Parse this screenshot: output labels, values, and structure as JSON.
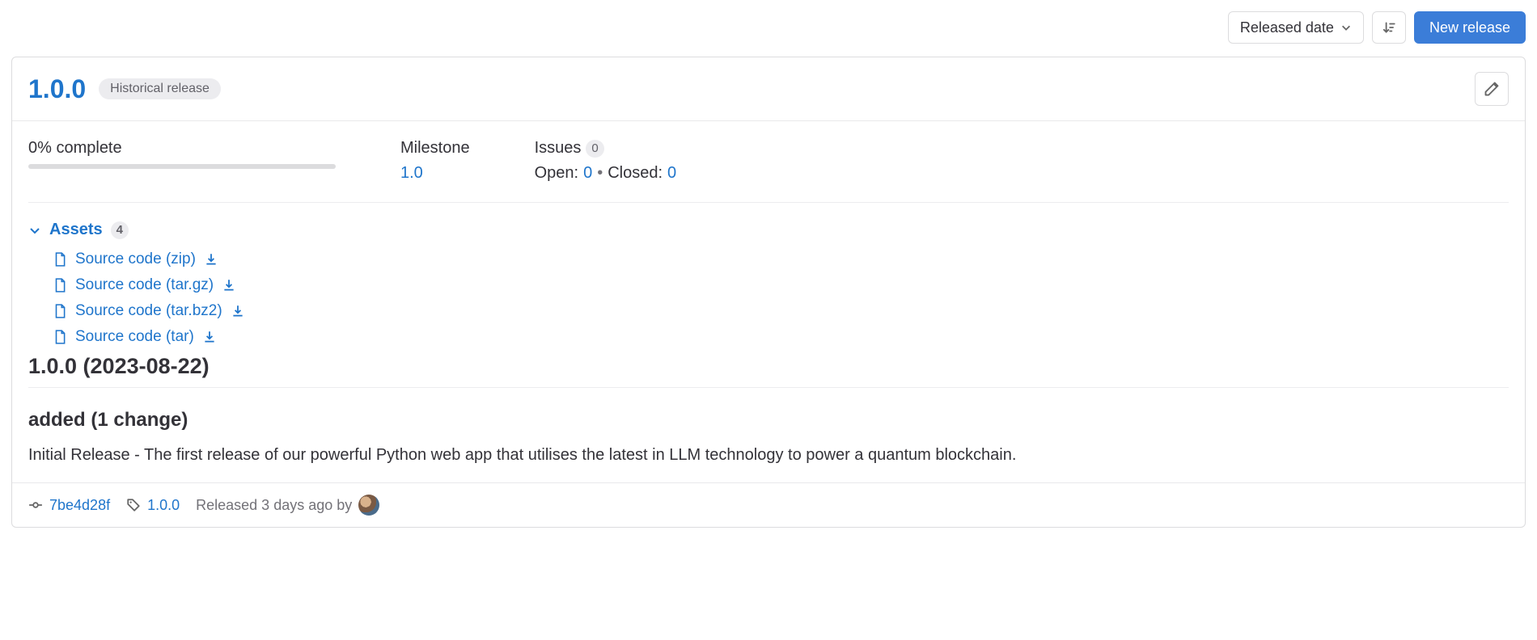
{
  "toolbar": {
    "sort_dropdown_label": "Released date",
    "new_release_label": "New release"
  },
  "release": {
    "title": "1.0.0",
    "badge": "Historical release",
    "progress_label": "0% complete",
    "milestone_heading": "Milestone",
    "milestone_link": "1.0",
    "issues_heading": "Issues",
    "issues_count": "0",
    "issues_open_label": "Open:",
    "issues_open_count": "0",
    "issues_closed_label": "Closed:",
    "issues_closed_count": "0",
    "assets_label": "Assets",
    "assets_count": "4",
    "assets": [
      {
        "label": "Source code (zip)"
      },
      {
        "label": "Source code (tar.gz)"
      },
      {
        "label": "Source code (tar.bz2)"
      },
      {
        "label": "Source code (tar)"
      }
    ],
    "notes_heading": "1.0.0 (2023-08-22)",
    "notes_subheading": "added (1 change)",
    "notes_body": "Initial Release - The first release of our powerful Python web app that utilises the latest in LLM technology to power a quantum blockchain.",
    "footer": {
      "commit_sha": "7be4d28f",
      "tag": "1.0.0",
      "released_text": "Released 3 days ago by"
    }
  }
}
